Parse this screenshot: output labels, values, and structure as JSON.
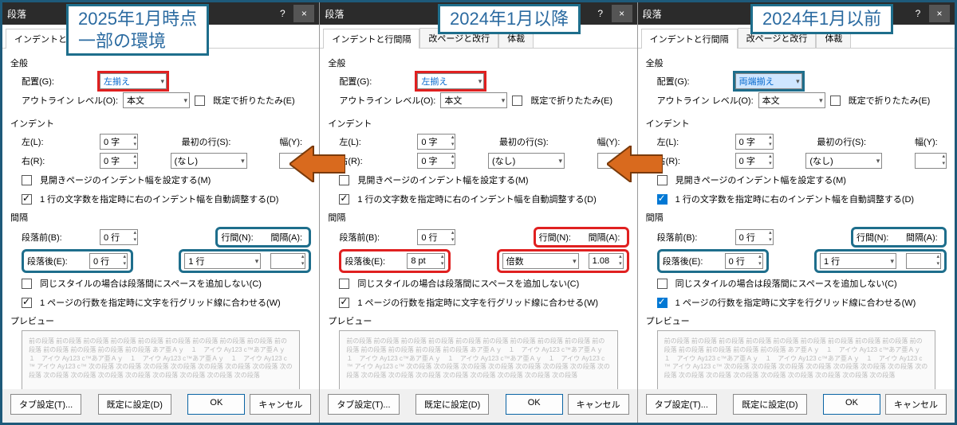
{
  "dialog_title": "段落",
  "titlebar_help": "?",
  "titlebar_close": "×",
  "tabs": {
    "t1": "インデントと行間隔",
    "t2": "改ページと改行",
    "t3": "体裁"
  },
  "sections": {
    "general": "全般",
    "indent": "インデント",
    "spacing": "間隔",
    "preview": "プレビュー"
  },
  "labels": {
    "align": "配置(G):",
    "outline": "アウトライン レベル(O):",
    "fold": "既定で折りたたみ(E)",
    "left": "左(L):",
    "right": "右(R):",
    "firstline": "最初の行(S):",
    "width": "幅(Y):",
    "mirror": "見開きページのインデント幅を設定する(M)",
    "auto_indent": "1 行の文字数を指定時に右のインデント幅を自動調整する(D)",
    "before": "段落前(B):",
    "after": "段落後(E):",
    "line_spacing": "行間(N):",
    "gap": "間隔(A):",
    "same_style": "同じスタイルの場合は段落間にスペースを追加しない(C)",
    "grid_align": "1 ページの行数を指定時に文字を行グリッド線に合わせる(W)",
    "tabs_btn": "タブ設定(T)...",
    "default_btn": "既定に設定(D)",
    "ok": "OK",
    "cancel": "キャンセル"
  },
  "values": {
    "outline": "本文",
    "zero_ji": "0 字",
    "none": "(なし)",
    "zero_gyou": "0 行",
    "one_gyou": "1 行",
    "left_align": "左揃え",
    "justify": "両端揃え",
    "eight_pt": "8 pt",
    "baisuu": "倍数",
    "one08": "1.08"
  },
  "callouts": {
    "c1a": "2025年1月時点",
    "c1b": "一部の環境",
    "c2": "2024年1月以降",
    "c3": "2024年1月以前"
  },
  "preview_text": "前の段落 前の段落 前の段落 前の段落 前の段落 前の段落 前の段落 前の段落 前の段落 前の段落 前の段落 前の段落 前の段落 前の段落\nあア亜Ａｙ　１　アイウ Ay123 c™あア亜Ａｙ　１　アイウ Ay123 c™あア亜Ａｙ　１　アイウ Ay123 c™あア亜Ａｙ　１　アイウ Ay123 c™\nアイウ Ay123 c™\n次の段落 次の段落 次の段落 次の段落 次の段落 次の段落 次の段落 次の段落 次の段落 次の段落 次の段落 次の段落 次の段落 次の段落 次の段落 次の段落"
}
